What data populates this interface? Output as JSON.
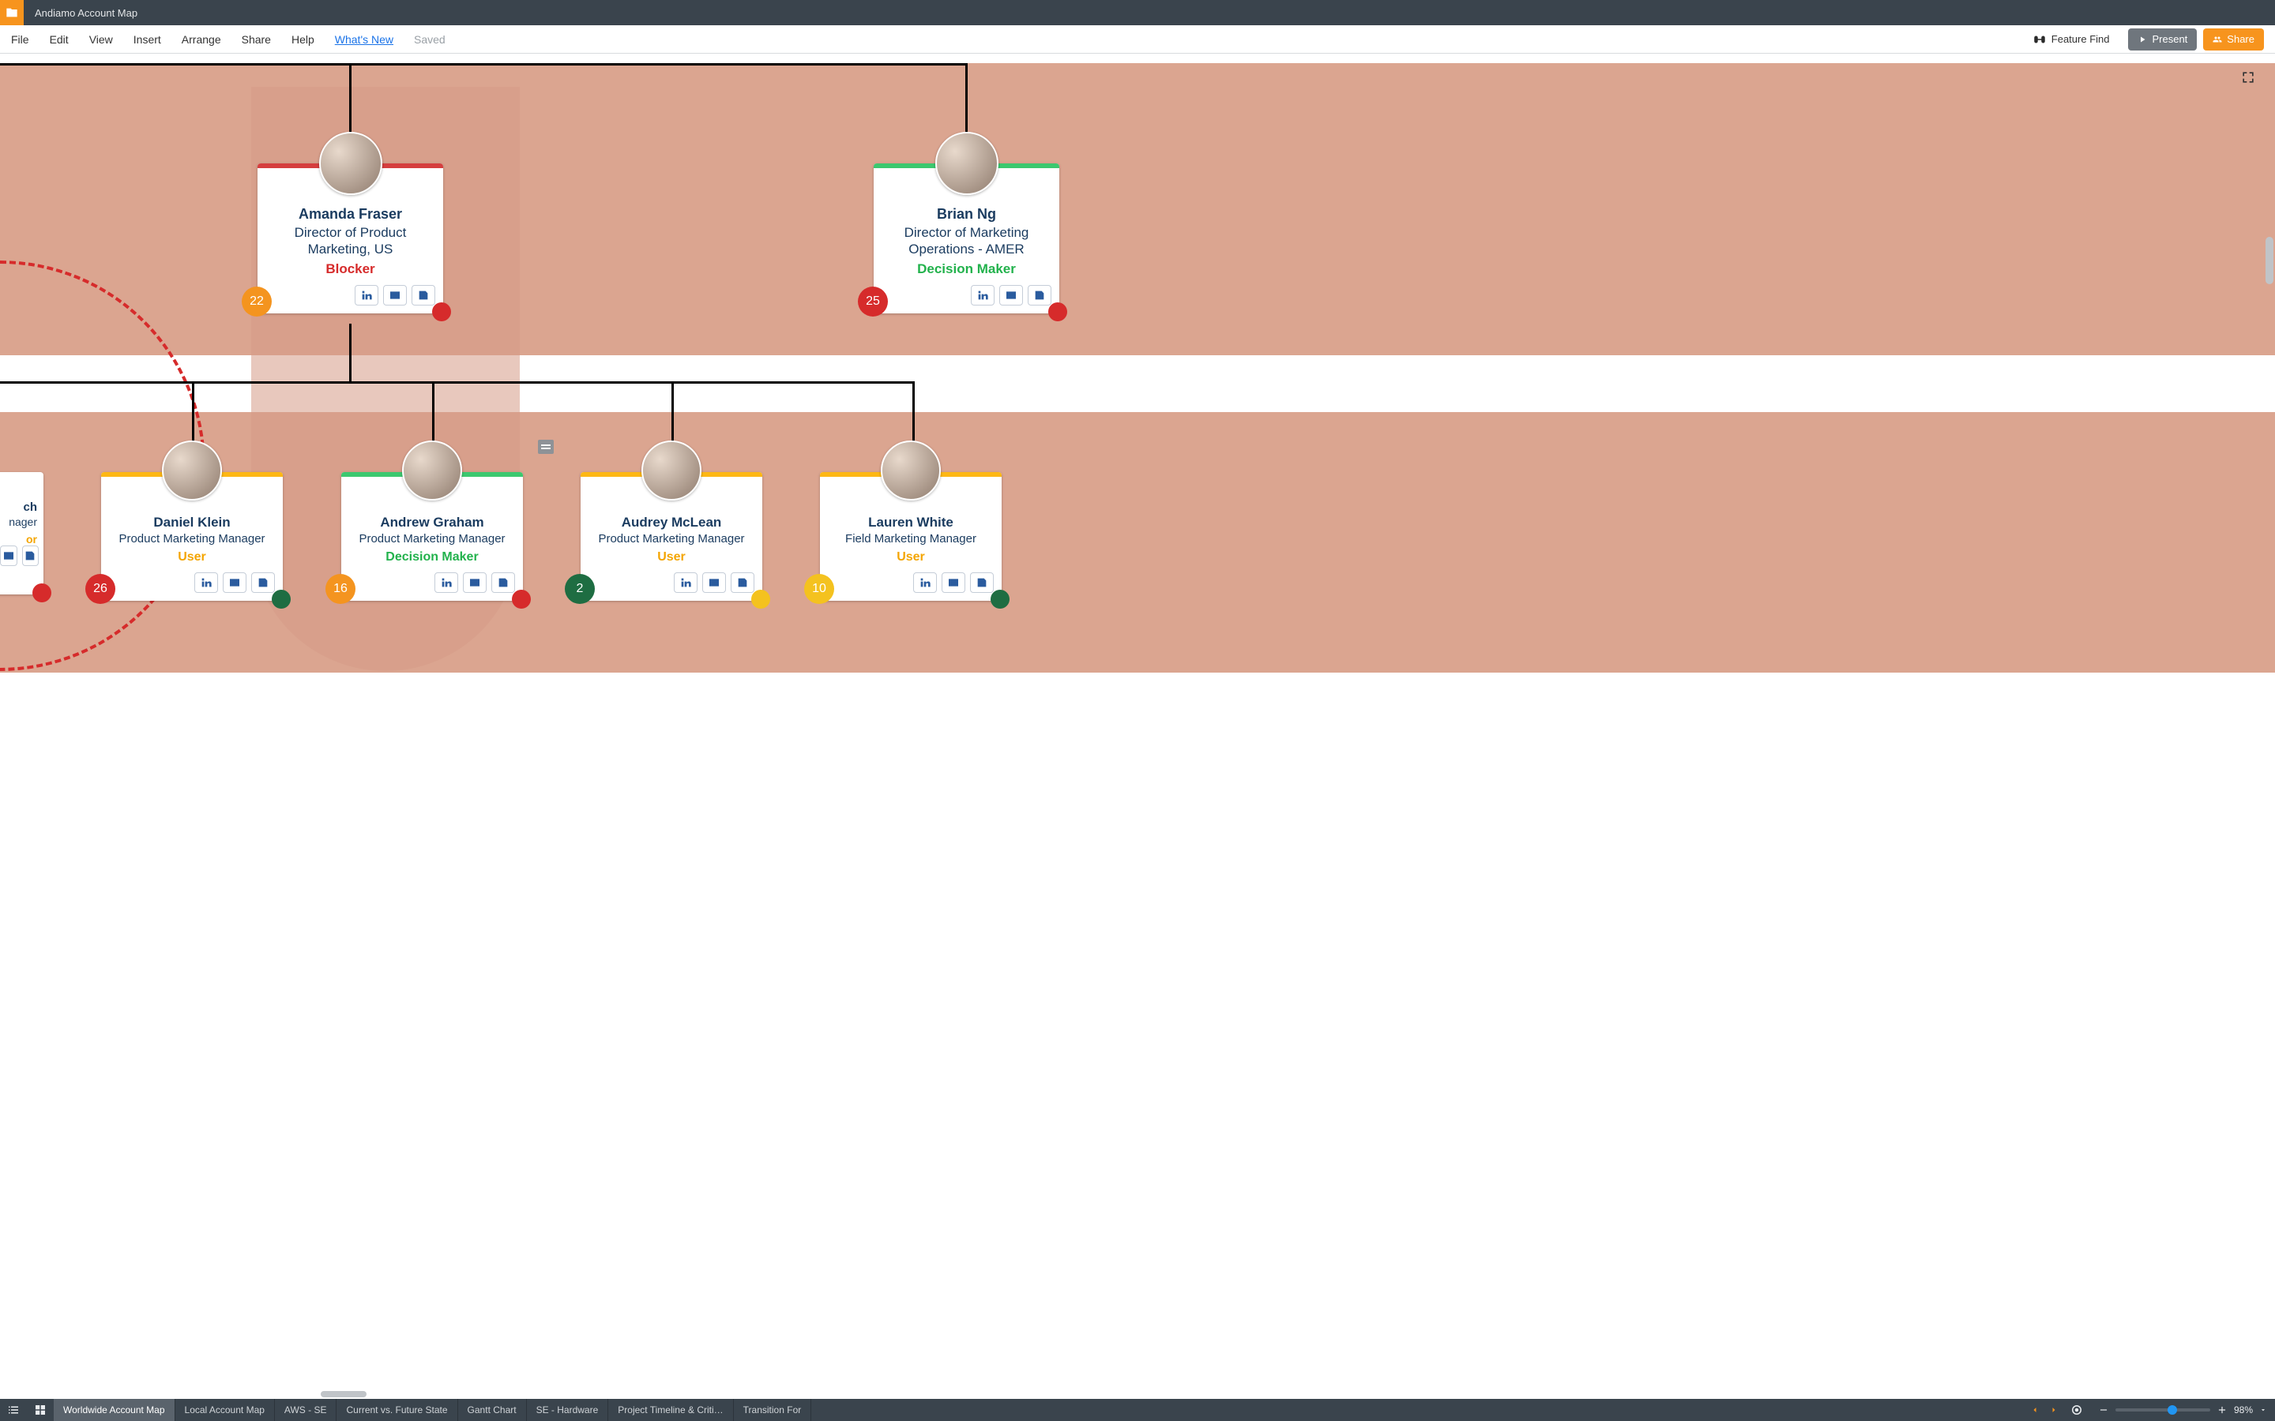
{
  "titlebar": {
    "title": "Andiamo Account Map"
  },
  "menu": {
    "items": [
      "File",
      "Edit",
      "View",
      "Insert",
      "Arrange",
      "Share",
      "Help"
    ],
    "whats_new": "What's New",
    "saved": "Saved",
    "feature_find": "Feature Find",
    "present": "Present",
    "share": "Share"
  },
  "canvas": {
    "expand": "expand",
    "cards": {
      "amanda": {
        "name": "Amanda Fraser",
        "title": "Director of Product Marketing, US",
        "role": "Blocker",
        "badge_left": "22"
      },
      "brian": {
        "name": "Brian Ng",
        "title": "Director of Marketing Operations - AMER",
        "role": "Decision Maker",
        "badge_left": "25"
      },
      "daniel": {
        "name": "Daniel Klein",
        "title": "Product Marketing Manager",
        "role": "User",
        "badge_left": "26"
      },
      "andrew": {
        "name": "Andrew Graham",
        "title": "Product Marketing Manager",
        "role": "Decision Maker",
        "badge_left": "16"
      },
      "audrey": {
        "name": "Audrey McLean",
        "title": "Product Marketing Manager",
        "role": "User",
        "badge_left": "2"
      },
      "lauren": {
        "name": "Lauren White",
        "title": "Field Marketing Manager",
        "role": "User",
        "badge_left": "10"
      },
      "edge": {
        "name_frag": "ch",
        "title_frag1": "nager",
        "title_frag2": "or"
      }
    }
  },
  "tabs": {
    "items": [
      "Worldwide Account Map",
      "Local Account Map",
      "AWS - SE",
      "Current vs. Future State",
      "Gantt Chart",
      "SE - Hardware",
      "Project Timeline & Criti…",
      "Transition For"
    ],
    "active_index": 0
  },
  "zoom": {
    "value": "98%"
  }
}
